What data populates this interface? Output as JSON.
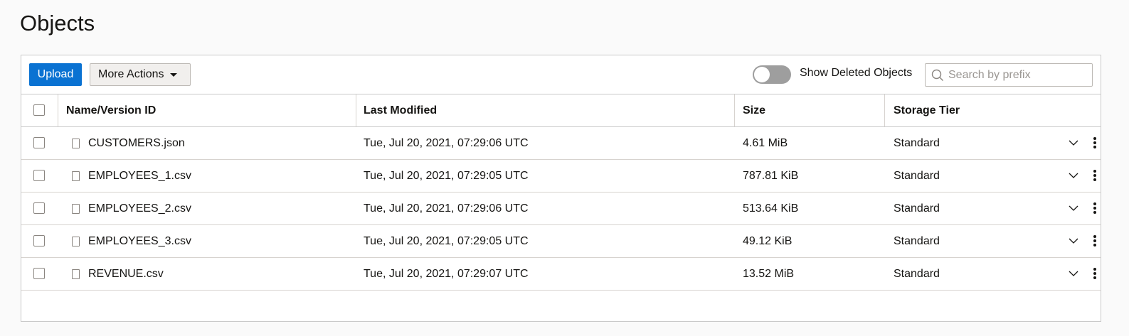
{
  "page": {
    "title": "Objects"
  },
  "toolbar": {
    "upload_label": "Upload",
    "more_actions_label": "More Actions",
    "show_deleted_label": "Show Deleted Objects",
    "show_deleted_on": false,
    "search_placeholder": "Search by prefix",
    "search_value": ""
  },
  "table": {
    "columns": [
      "Name/Version ID",
      "Last Modified",
      "Size",
      "Storage Tier"
    ],
    "rows": [
      {
        "name": "CUSTOMERS.json",
        "last_modified": "Tue, Jul 20, 2021, 07:29:06 UTC",
        "size": "4.61 MiB",
        "tier": "Standard"
      },
      {
        "name": "EMPLOYEES_1.csv",
        "last_modified": "Tue, Jul 20, 2021, 07:29:05 UTC",
        "size": "787.81 KiB",
        "tier": "Standard"
      },
      {
        "name": "EMPLOYEES_2.csv",
        "last_modified": "Tue, Jul 20, 2021, 07:29:06 UTC",
        "size": "513.64 KiB",
        "tier": "Standard"
      },
      {
        "name": "EMPLOYEES_3.csv",
        "last_modified": "Tue, Jul 20, 2021, 07:29:05 UTC",
        "size": "49.12 KiB",
        "tier": "Standard"
      },
      {
        "name": "REVENUE.csv",
        "last_modified": "Tue, Jul 20, 2021, 07:29:07 UTC",
        "size": "13.52 MiB",
        "tier": "Standard"
      }
    ]
  },
  "colors": {
    "accent": "#0a72d2",
    "toggle_off": "#9e9e9e",
    "border": "#c9c9c9"
  },
  "icons": {
    "search": "search-icon",
    "file": "file-icon",
    "expand": "chevron-down-icon",
    "actions": "kebab-menu-icon",
    "dropdown": "caret-down-icon"
  }
}
